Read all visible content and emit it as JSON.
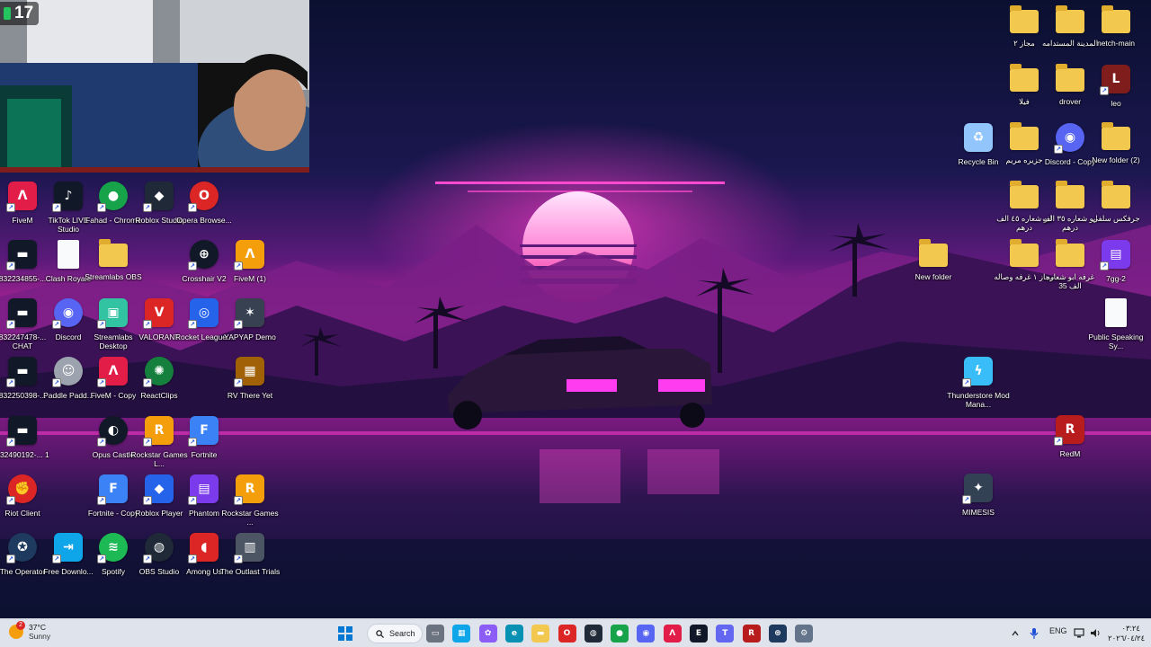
{
  "webcam": {
    "viewer_count": "17"
  },
  "desktop_left": [
    {
      "label": "FiveM",
      "icon": "fivem-icon",
      "color": "#e11d48",
      "glyph": "Λ"
    },
    {
      "label": "TikTok LIVE Studio",
      "icon": "tiktok-icon",
      "color": "#111827",
      "glyph": "♪"
    },
    {
      "label": "Fahad - Chrome",
      "icon": "chrome-icon",
      "color": "#16a34a",
      "glyph": "●"
    },
    {
      "label": "Roblox Studio",
      "icon": "roblox-studio-icon",
      "color": "#1f2937",
      "glyph": "◆"
    },
    {
      "label": "Opera Browse...",
      "icon": "opera-icon",
      "color": "#dc2626",
      "glyph": "O"
    },
    {
      "label": "832234855-...",
      "icon": "video-file-icon",
      "color": "#111827",
      "glyph": "▬"
    },
    {
      "label": "Clash Royale",
      "icon": "file-icon",
      "color": "#f8fafc",
      "glyph": ""
    },
    {
      "label": "Streamlabs OBS",
      "icon": "folder-icon",
      "color": "#f3c84f",
      "glyph": ""
    },
    {
      "label": "Crosshair V2",
      "icon": "crosshair-icon",
      "color": "#111827",
      "glyph": "⊕"
    },
    {
      "label": "FiveM (1)",
      "icon": "fivem-icon",
      "color": "#f59e0b",
      "glyph": "Λ"
    },
    {
      "label": "832247478-... CHAT",
      "icon": "video-file-icon",
      "color": "#111827",
      "glyph": "▬"
    },
    {
      "label": "Discord",
      "icon": "discord-icon",
      "color": "#5865f2",
      "glyph": "◉"
    },
    {
      "label": "Streamlabs Desktop",
      "icon": "streamlabs-icon",
      "color": "#31c3a2",
      "glyph": "▣"
    },
    {
      "label": "VALORANT",
      "icon": "valorant-icon",
      "color": "#dc2626",
      "glyph": "V"
    },
    {
      "label": "Rocket League...",
      "icon": "rocket-league-icon",
      "color": "#2563eb",
      "glyph": "◎"
    },
    {
      "label": "YAPYAP Demo",
      "icon": "yapyap-icon",
      "color": "#374151",
      "glyph": "✶"
    },
    {
      "label": "832250398-...",
      "icon": "video-file-icon",
      "color": "#111827",
      "glyph": "▬"
    },
    {
      "label": "Paddle Padd...",
      "icon": "paddle-icon",
      "color": "#9ca3af",
      "glyph": "☺"
    },
    {
      "label": "FiveM - Copy",
      "icon": "fivem-icon",
      "color": "#e11d48",
      "glyph": "Λ"
    },
    {
      "label": "ReactClips",
      "icon": "reactclips-icon",
      "color": "#15803d",
      "glyph": "✺"
    },
    {
      "label": "RV There Yet",
      "icon": "rv-there-yet-icon",
      "color": "#a16207",
      "glyph": "▦"
    },
    {
      "label": "832490192-... 1",
      "icon": "video-file-icon",
      "color": "#111827",
      "glyph": "▬"
    },
    {
      "label": "Opus Castle",
      "icon": "opus-castle-icon",
      "color": "#111827",
      "glyph": "◐"
    },
    {
      "label": "Rockstar Games L...",
      "icon": "rockstar-icon",
      "color": "#f59e0b",
      "glyph": "R"
    },
    {
      "label": "Fortnite",
      "icon": "fortnite-icon",
      "color": "#3b82f6",
      "glyph": "F"
    },
    {
      "label": "Riot Client",
      "icon": "riot-client-icon",
      "color": "#dc2626",
      "glyph": "✊"
    },
    {
      "label": "Fortnite - Copy",
      "icon": "fortnite-icon",
      "color": "#3b82f6",
      "glyph": "F"
    },
    {
      "label": "Roblox Player",
      "icon": "roblox-player-icon",
      "color": "#2563eb",
      "glyph": "◆"
    },
    {
      "label": "Phantom",
      "icon": "winrar-icon",
      "color": "#7c3aed",
      "glyph": "▤"
    },
    {
      "label": "Rockstar Games ...",
      "icon": "rockstar-icon",
      "color": "#f59e0b",
      "glyph": "R"
    },
    {
      "label": "The Operator",
      "icon": "operator-icon",
      "color": "#1e3a5f",
      "glyph": "✪"
    },
    {
      "label": "Free Downlo...",
      "icon": "download-icon",
      "color": "#0ea5e9",
      "glyph": "⇥"
    },
    {
      "label": "Spotify",
      "icon": "spotify-icon",
      "color": "#1db954",
      "glyph": "≋"
    },
    {
      "label": "OBS Studio",
      "icon": "obs-icon",
      "color": "#1f2937",
      "glyph": "◍"
    },
    {
      "label": "Among Us",
      "icon": "among-us-icon",
      "color": "#dc2626",
      "glyph": "◖"
    },
    {
      "label": "The Outlast Trials",
      "icon": "outlast-icon",
      "color": "#4b5563",
      "glyph": "▥"
    }
  ],
  "desktop_right": [
    {
      "label": "مجاز ٢",
      "icon": "folder-icon",
      "color": "#f3c84f",
      "glyph": ""
    },
    {
      "label": "المدينة المستدامه",
      "icon": "folder-icon",
      "color": "#f3c84f",
      "glyph": ""
    },
    {
      "label": "netch-main",
      "icon": "folder-icon",
      "color": "#f3c84f",
      "glyph": ""
    },
    {
      "label": "فيلا",
      "icon": "folder-icon",
      "color": "#f3c84f",
      "glyph": ""
    },
    {
      "label": "drover",
      "icon": "folder-icon",
      "color": "#f3c84f",
      "glyph": ""
    },
    {
      "label": "leo",
      "icon": "leo-icon",
      "color": "#7f1d1d",
      "glyph": "L"
    },
    {
      "label": "Recycle Bin",
      "icon": "recycle-bin-icon",
      "color": "#93c5fd",
      "glyph": "♻"
    },
    {
      "label": "جزيره مريم",
      "icon": "folder-icon",
      "color": "#f3c84f",
      "glyph": ""
    },
    {
      "label": "Discord - Copy",
      "icon": "discord-icon",
      "color": "#5865f2",
      "glyph": "◉"
    },
    {
      "label": "New folder (2)",
      "icon": "folder-icon",
      "color": "#f3c84f",
      "glyph": ""
    },
    {
      "label": "ابو شعاره ٤٥ الف درهم",
      "icon": "folder-icon",
      "color": "#f3c84f",
      "glyph": ""
    },
    {
      "label": "ابو شعاره ٣٥ الف درهم",
      "icon": "folder-icon",
      "color": "#f3c84f",
      "glyph": ""
    },
    {
      "label": "جرفكس سلفي",
      "icon": "folder-icon",
      "color": "#f3c84f",
      "glyph": ""
    },
    {
      "label": "New folder",
      "icon": "folder-icon",
      "color": "#f3c84f",
      "glyph": ""
    },
    {
      "label": "مجاز ١ غرفه وصاله",
      "icon": "folder-icon",
      "color": "#f3c84f",
      "glyph": ""
    },
    {
      "label": "غرفه ابو شعاره الف 35",
      "icon": "folder-icon",
      "color": "#f3c84f",
      "glyph": ""
    },
    {
      "label": "7gg-2",
      "icon": "winrar-icon",
      "color": "#7c3aed",
      "glyph": "▤"
    },
    {
      "label": "Public Speaking Sy...",
      "icon": "file-icon",
      "color": "#f8fafc",
      "glyph": ""
    },
    {
      "label": "Thunderstore Mod Mana...",
      "icon": "thunderstore-icon",
      "color": "#38bdf8",
      "glyph": "ϟ"
    },
    {
      "label": "RedM",
      "icon": "redm-icon",
      "color": "#b91c1c",
      "glyph": "R"
    },
    {
      "label": "MIMESIS",
      "icon": "mimesis-icon",
      "color": "#334155",
      "glyph": "✦"
    }
  ],
  "taskbar": {
    "weather_temp": "37°C",
    "weather_condition": "Sunny",
    "weather_alert": "2",
    "search_label": "Search",
    "pinned": [
      {
        "name": "file-explorer-icon",
        "color": "#6b7280",
        "glyph": "▭"
      },
      {
        "name": "microsoft-store-icon",
        "color": "#0ea5e9",
        "glyph": "▦"
      },
      {
        "name": "copilot-icon",
        "color": "#8b5cf6",
        "glyph": "✿"
      },
      {
        "name": "edge-icon",
        "color": "#0891b2",
        "glyph": "e"
      },
      {
        "name": "folder-icon",
        "color": "#f3c84f",
        "glyph": "▬"
      },
      {
        "name": "opera-icon",
        "color": "#dc2626",
        "glyph": "O"
      },
      {
        "name": "obs-icon",
        "color": "#1f2937",
        "glyph": "◍"
      },
      {
        "name": "chrome-icon",
        "color": "#16a34a",
        "glyph": "●"
      },
      {
        "name": "discord-icon",
        "color": "#5865f2",
        "glyph": "◉"
      },
      {
        "name": "fivem-icon",
        "color": "#e11d48",
        "glyph": "Λ"
      },
      {
        "name": "epic-games-icon",
        "color": "#111827",
        "glyph": "E"
      },
      {
        "name": "teams-icon",
        "color": "#6366f1",
        "glyph": "T"
      },
      {
        "name": "redm-icon",
        "color": "#b91c1c",
        "glyph": "R"
      },
      {
        "name": "steam-icon",
        "color": "#1e3a5f",
        "glyph": "⊛"
      },
      {
        "name": "settings-icon",
        "color": "#64748b",
        "glyph": "⚙"
      }
    ],
    "language": "ENG",
    "time": "٠٣:٢٤",
    "date": "٢٠٢٦/٠٤/٢٤"
  }
}
